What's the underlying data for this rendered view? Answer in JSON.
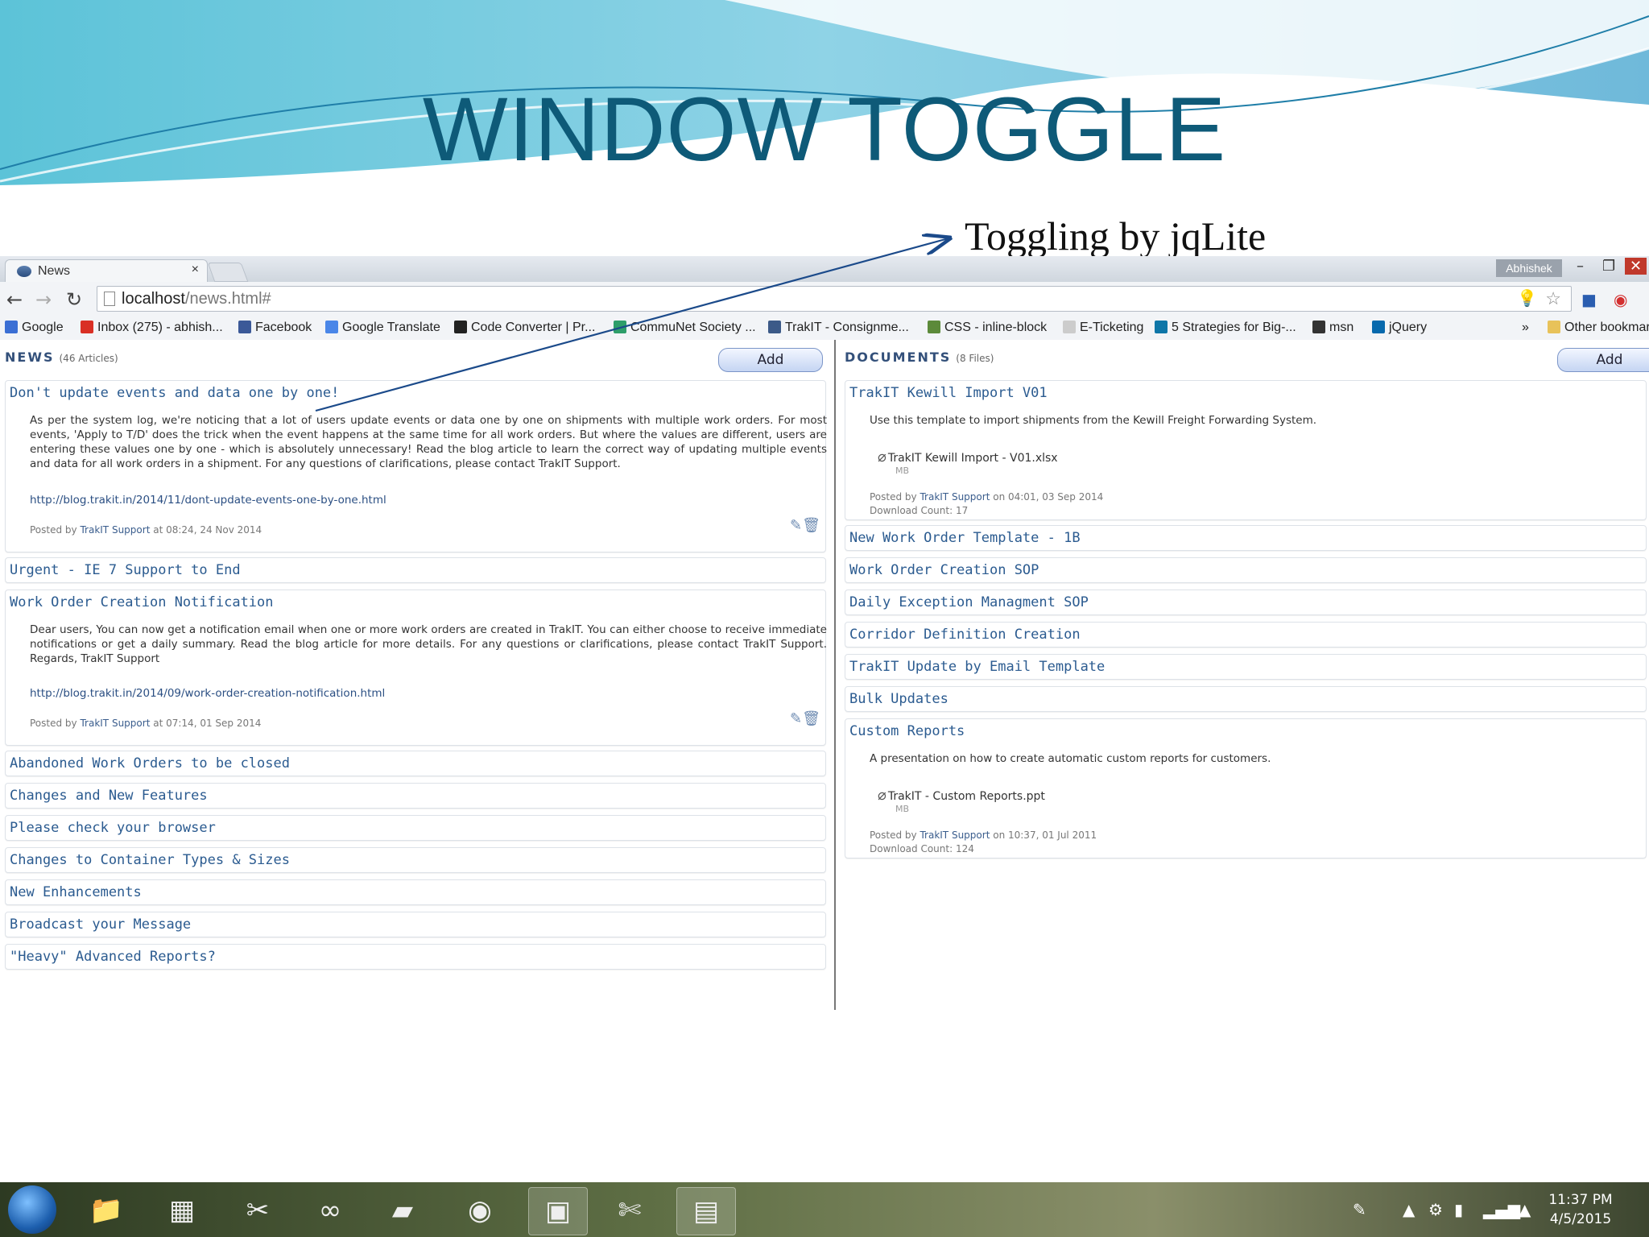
{
  "slide": {
    "title": "WINDOW TOGGLE",
    "annotation": "Toggling by jqLite"
  },
  "browser": {
    "tab_label": "News",
    "tab_close": "×",
    "user_badge": "Abhishek",
    "address_host": "localhost",
    "address_path": "/news.html#",
    "bookmarks": [
      {
        "label": "Google",
        "icon_color": "#3b6fd4"
      },
      {
        "label": "Inbox (275) - abhish...",
        "icon_color": "#d93025"
      },
      {
        "label": "Facebook",
        "icon_color": "#3b5998"
      },
      {
        "label": "Google Translate",
        "icon_color": "#4a86e8"
      },
      {
        "label": "Code Converter | Pr...",
        "icon_color": "#222222"
      },
      {
        "label": "CommuNet Society ...",
        "icon_color": "#2e9e6a"
      },
      {
        "label": "TrakIT - Consignme...",
        "icon_color": "#3c5a88"
      },
      {
        "label": "CSS - inline-block",
        "icon_color": "#5c8a3a"
      },
      {
        "label": "E-Ticketing",
        "icon_color": "#cccccc"
      },
      {
        "label": "5 Strategies for Big-...",
        "icon_color": "#0e76a8"
      },
      {
        "label": "msn",
        "icon_color": "#333333"
      },
      {
        "label": "jQuery",
        "icon_color": "#0769ad"
      }
    ],
    "bookmarks_more": "»",
    "other_bookmarks": "Other bookmarks"
  },
  "news": {
    "heading": "NEWS",
    "count": "(46 Articles)",
    "add_label": "Add",
    "expanded": [
      {
        "title": "Don't update events and data one by one!",
        "body": "As per the system log, we're noticing that a lot of users update events or data one by one on shipments with multiple work orders. For most events, 'Apply to T/D' does the trick when the event happens at the same time for all work orders. But where the values are different, users are entering these values one by one - which is absolutely unnecessary! Read the blog article to learn the correct way of updating multiple events and data for all work orders in a shipment. For any questions of clarifications, please contact TrakIT Support.",
        "link": "http://blog.trakit.in/2014/11/dont-update-events-one-by-one.html",
        "posted_prefix": "Posted by",
        "posted_by": "TrakIT Support",
        "posted_when": "at 08:24, 24 Nov 2014"
      },
      {
        "title": "Work Order Creation Notification",
        "body": "Dear users, You can now get a notification email when one or more work orders are created in TrakIT. You can either choose to receive immediate notifications or get a daily summary. Read the blog article for more details. For any questions or clarifications, please contact TrakIT Support. Regards, TrakIT Support",
        "link": "http://blog.trakit.in/2014/09/work-order-creation-notification.html",
        "posted_prefix": "Posted by",
        "posted_by": "TrakIT Support",
        "posted_when": "at 07:14, 01 Sep 2014"
      }
    ],
    "collapsed_after_first": [
      "Urgent - IE 7 Support to End"
    ],
    "collapsed_after_second": [
      "Abandoned Work Orders to be closed",
      "Changes and New Features",
      "Please check your browser",
      "Changes to Container Types & Sizes",
      "New Enhancements",
      "Broadcast your Message",
      "\"Heavy\" Advanced Reports?"
    ]
  },
  "documents": {
    "heading": "DOCUMENTS",
    "count": "(8 Files)",
    "add_label": "Add",
    "first": {
      "title": "TrakIT Kewill Import V01",
      "body": "Use this template to import shipments from the Kewill Freight Forwarding System.",
      "file": "TrakIT Kewill Import - V01.xlsx",
      "size": "MB",
      "posted_prefix": "Posted by",
      "posted_by": "TrakIT Support",
      "posted_when": "on 04:01, 03 Sep 2014",
      "downloads": "Download Count: 17"
    },
    "collapsed": [
      "New Work Order Template - 1B",
      "Work Order Creation SOP",
      "Daily Exception Managment SOP",
      "Corridor Definition Creation",
      "TrakIT Update by Email Template",
      "Bulk Updates"
    ],
    "last": {
      "title": "Custom Reports",
      "body": "A presentation on how to create automatic custom reports for customers.",
      "file": "TrakIT - Custom Reports.ppt",
      "size": "MB",
      "posted_prefix": "Posted by",
      "posted_by": "TrakIT Support",
      "posted_when": "on 10:37, 01 Jul 2011",
      "downloads": "Download Count: 124"
    }
  },
  "taskbar": {
    "time": "11:37 PM",
    "date": "4/5/2015"
  },
  "colors": {
    "title": "#0e5a78",
    "accent_blue": "#2b7bbf",
    "link_blue": "#2b5b90"
  }
}
